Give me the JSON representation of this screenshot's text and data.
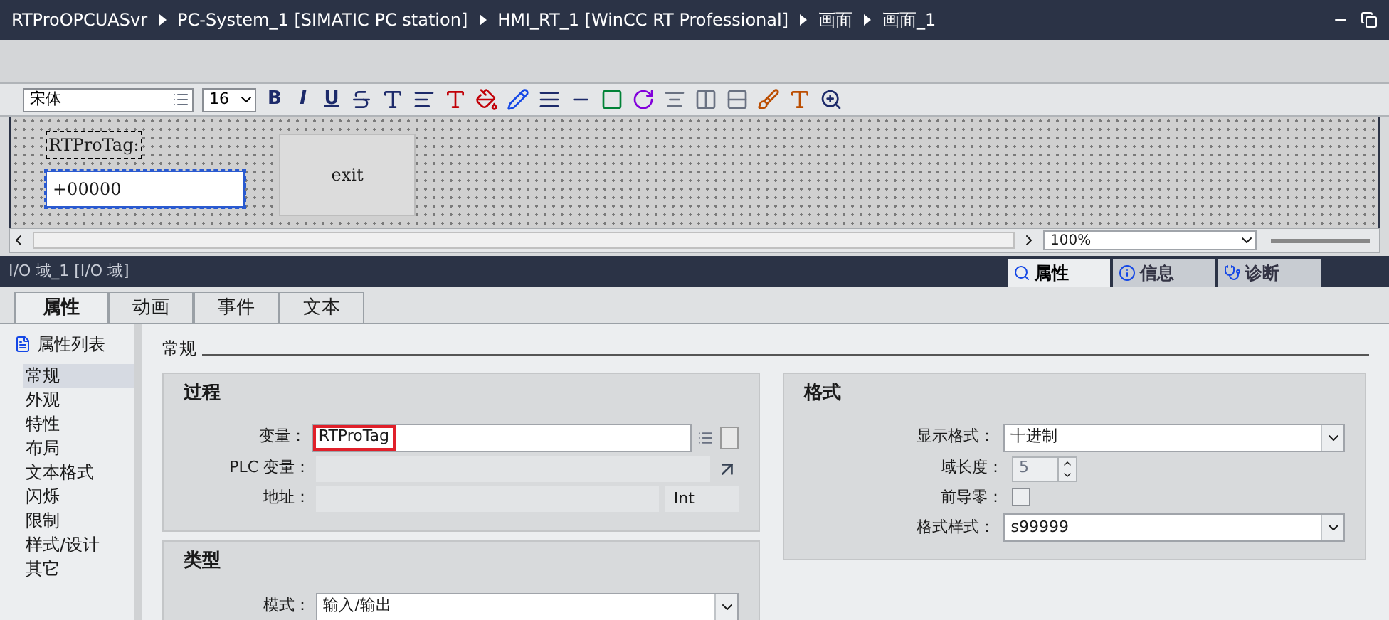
{
  "title_bar": {
    "breadcrumbs": [
      "RTProOPCUASvr",
      "PC-System_1 [SIMATIC PC station]",
      "HMI_RT_1 [WinCC RT Professional]",
      "画面",
      "画面_1"
    ]
  },
  "toolbar": {
    "font": "宋体",
    "size": "16",
    "letter_buttons": [
      "B",
      "I",
      "U"
    ]
  },
  "canvas": {
    "label": "RTProTag:",
    "io_field": {
      "value": "+00000",
      "selected": true
    },
    "button": "exit"
  },
  "view_bar": {
    "zoom": "100%"
  },
  "inspector": {
    "title": "I/O 域_1 [I/O 域]",
    "right_tabs": [
      {
        "label": "属性",
        "selected": true
      },
      {
        "label": "信息",
        "selected": false
      },
      {
        "label": "诊断",
        "selected": false
      }
    ],
    "tabs": [
      {
        "label": "属性",
        "selected": true
      },
      {
        "label": "动画",
        "selected": false
      },
      {
        "label": "事件",
        "selected": false
      },
      {
        "label": "文本",
        "selected": false
      }
    ],
    "sidebar": {
      "header": "属性列表",
      "items": [
        {
          "label": "常规",
          "selected": true
        },
        {
          "label": "外观",
          "selected": false
        },
        {
          "label": "特性",
          "selected": false
        },
        {
          "label": "布局",
          "selected": false
        },
        {
          "label": "文本格式",
          "selected": false
        },
        {
          "label": "闪烁",
          "selected": false
        },
        {
          "label": "限制",
          "selected": false
        },
        {
          "label": "样式/设计",
          "selected": false
        },
        {
          "label": "其它",
          "selected": false
        }
      ]
    },
    "section": "常规",
    "process": {
      "title": "过程",
      "tag_label": "变量：",
      "tag_value": "RTProTag",
      "plc_label": "PLC 变量：",
      "address_label": "地址：",
      "address_type": "Int"
    },
    "type": {
      "title": "类型",
      "mode_label": "模式：",
      "mode_value": "输入/输出"
    },
    "format": {
      "title": "格式",
      "display_label": "显示格式：",
      "display_value": "十进制",
      "length_label": "域长度：",
      "length_value": "5",
      "leading_zeros_label": "前导零：",
      "leading_zeros": false,
      "pattern_label": "格式样式：",
      "pattern_value": "s99999"
    }
  }
}
